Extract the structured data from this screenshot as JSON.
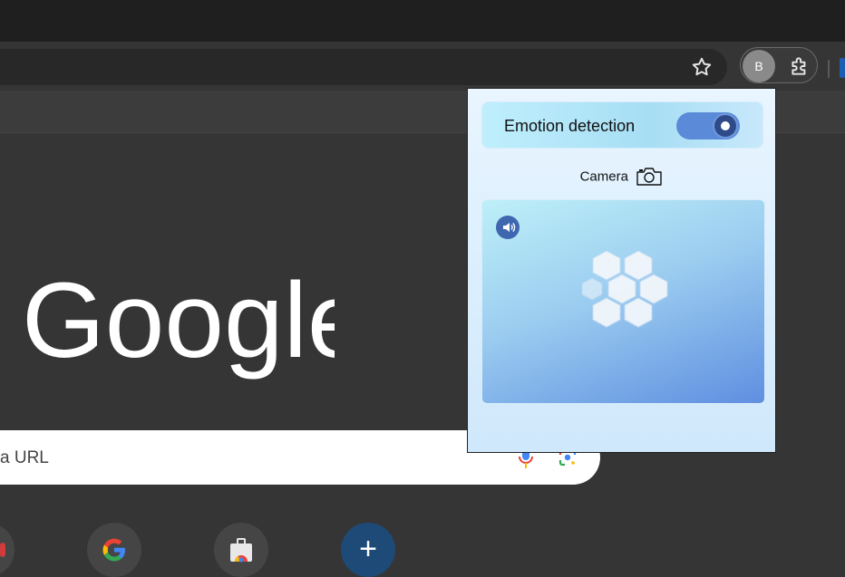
{
  "browser": {
    "profile_initial": "B",
    "icons": [
      "star-icon",
      "puzzle-icon"
    ]
  },
  "new_tab": {
    "logo_text": "Google",
    "search_placeholder": "a URL",
    "shortcuts": [
      "shortcut-partial",
      "google-shortcut",
      "chrome-web-store-shortcut",
      "add-shortcut"
    ],
    "add_shortcut_symbol": "+"
  },
  "popup": {
    "toggle_label": "Emotion detection",
    "toggle_on": true,
    "camera_label": "Camera",
    "colors": {
      "switch_track": "#5b8ad8",
      "switch_knob": "#2e4a88",
      "sound_button": "#3f67b0"
    }
  }
}
